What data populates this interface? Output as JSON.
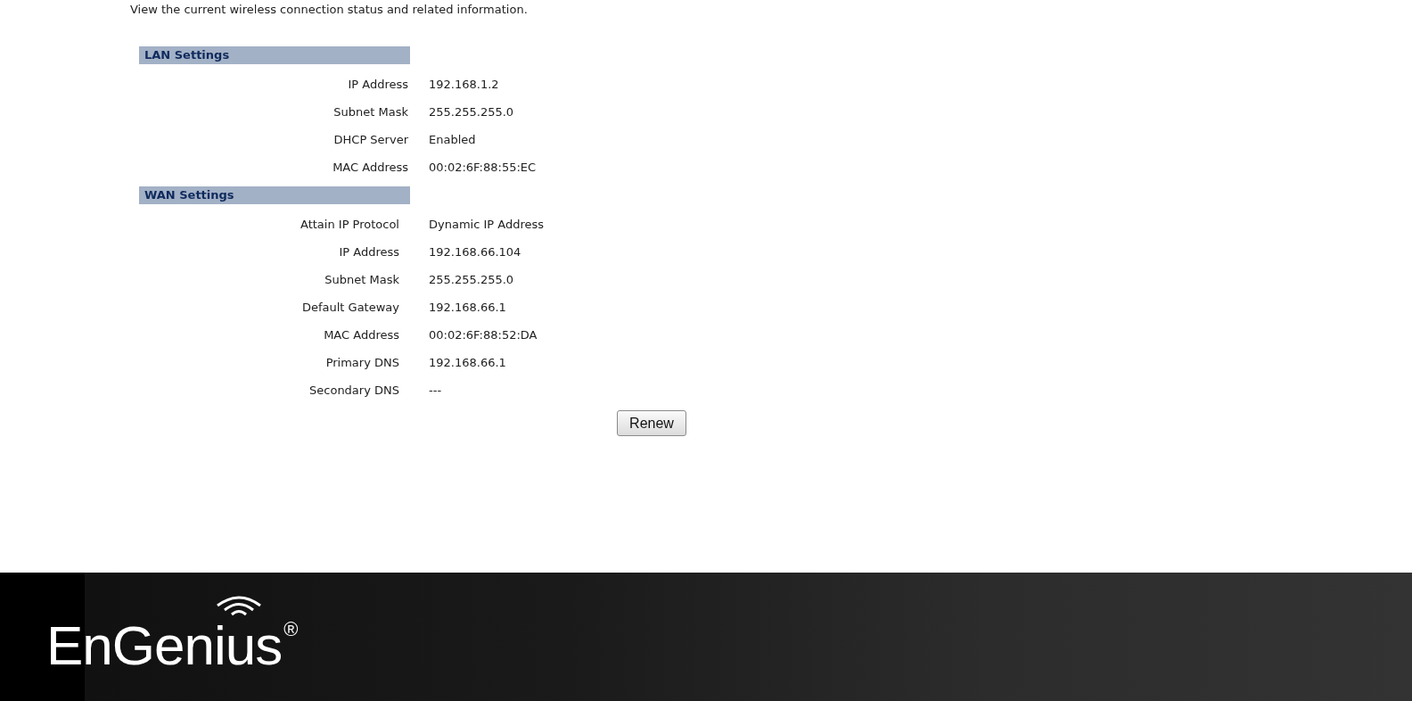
{
  "intro": "View the current wireless connection status and related information.",
  "sections": [
    {
      "title": "LAN Settings",
      "rows": [
        {
          "label": "IP Address",
          "value": "192.168.1.2"
        },
        {
          "label": "Subnet Mask",
          "value": "255.255.255.0"
        },
        {
          "label": "DHCP Server",
          "value": "Enabled"
        },
        {
          "label": "MAC Address",
          "value": "00:02:6F:88:55:EC"
        }
      ]
    },
    {
      "title": "WAN Settings",
      "rows": [
        {
          "label": "Attain IP Protocol",
          "value": "Dynamic IP Address"
        },
        {
          "label": "IP Address",
          "value": "192.168.66.104"
        },
        {
          "label": "Subnet Mask",
          "value": "255.255.255.0"
        },
        {
          "label": "Default Gateway",
          "value": "192.168.66.1"
        },
        {
          "label": "MAC Address",
          "value": "00:02:6F:88:52:DA"
        },
        {
          "label": "Primary DNS",
          "value": "192.168.66.1"
        },
        {
          "label": "Secondary DNS",
          "value": "---"
        }
      ]
    }
  ],
  "button": "Renew",
  "footer": {
    "logo": "EnGenius$^{®}$"
  }
}
